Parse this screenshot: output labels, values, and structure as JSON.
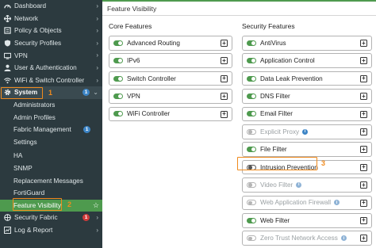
{
  "sidebar": {
    "items": [
      {
        "label": "Dashboard",
        "icon": "dashboard-icon",
        "chevron": "›"
      },
      {
        "label": "Network",
        "icon": "network-icon",
        "chevron": "›"
      },
      {
        "label": "Policy & Objects",
        "icon": "policy-icon",
        "chevron": "›"
      },
      {
        "label": "Security Profiles",
        "icon": "security-profiles-icon",
        "chevron": "›"
      },
      {
        "label": "VPN",
        "icon": "vpn-icon",
        "chevron": "›"
      },
      {
        "label": "User & Authentication",
        "icon": "user-icon",
        "chevron": "›"
      },
      {
        "label": "WiFi & Switch Controller",
        "icon": "wifi-icon",
        "chevron": "›"
      },
      {
        "label": "System",
        "icon": "gear-icon",
        "badge": "1",
        "chevron": "⌄"
      }
    ],
    "system_sub": [
      {
        "label": "Administrators"
      },
      {
        "label": "Admin Profiles"
      },
      {
        "label": "Fabric Management",
        "badge": "1"
      },
      {
        "label": "Settings"
      },
      {
        "label": "HA"
      },
      {
        "label": "SNMP"
      },
      {
        "label": "Replacement Messages"
      },
      {
        "label": "FortiGuard"
      },
      {
        "label": "Feature Visibility"
      }
    ],
    "bottom": [
      {
        "label": "Security Fabric",
        "icon": "security-fabric-icon",
        "badge": "1",
        "chevron": "›"
      },
      {
        "label": "Log & Report",
        "icon": "log-report-icon",
        "chevron": "›"
      }
    ]
  },
  "annotations": {
    "one": "1",
    "two": "2",
    "three": "3"
  },
  "main": {
    "title": "Feature Visibility",
    "core": {
      "heading": "Core Features",
      "items": [
        {
          "label": "Advanced Routing",
          "state": "on"
        },
        {
          "label": "IPv6",
          "state": "on"
        },
        {
          "label": "Switch Controller",
          "state": "on"
        },
        {
          "label": "VPN",
          "state": "on"
        },
        {
          "label": "WiFi Controller",
          "state": "on"
        }
      ]
    },
    "security": {
      "heading": "Security Features",
      "items": [
        {
          "label": "AntiVirus",
          "state": "on"
        },
        {
          "label": "Application Control",
          "state": "on"
        },
        {
          "label": "Data Leak Prevention",
          "state": "on"
        },
        {
          "label": "DNS Filter",
          "state": "on"
        },
        {
          "label": "Email Filter",
          "state": "on"
        },
        {
          "label": "Explicit Proxy",
          "state": "dim"
        },
        {
          "label": "File Filter",
          "state": "on"
        },
        {
          "label": "Intrusion Prevention",
          "state": "off"
        },
        {
          "label": "Video Filter",
          "state": "dim"
        },
        {
          "label": "Web Application Firewall",
          "state": "dim"
        },
        {
          "label": "Web Filter",
          "state": "on"
        },
        {
          "label": "Zero Trust Network Access",
          "state": "dim"
        }
      ]
    },
    "plus_symbol": "+",
    "info_symbol": "i"
  },
  "colors": {
    "accent_green": "#4e9a4e",
    "highlight_orange": "#f08a1d",
    "sidebar_bg": "#2c3a3f",
    "info_blue": "#3d85c6",
    "badge_red": "#d13a3a"
  }
}
